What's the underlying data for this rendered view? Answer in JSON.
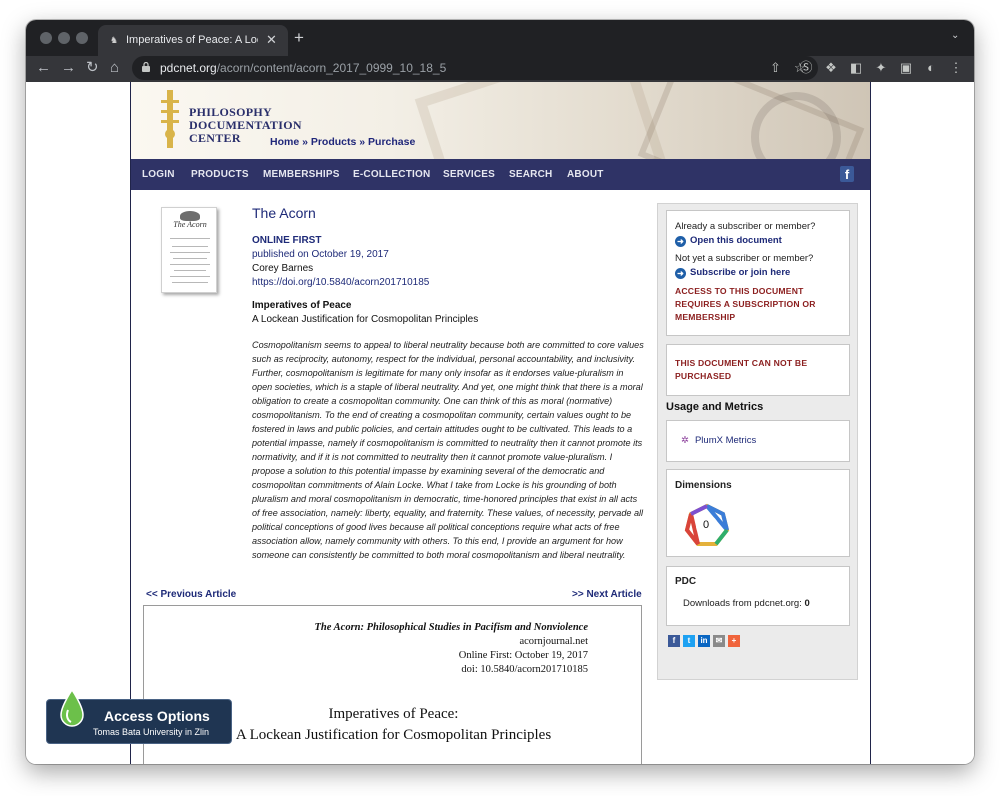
{
  "browser": {
    "tab_title": "Imperatives of Peace: A Locke",
    "url_host": "pdcnet.org",
    "url_path": "/acorn/content/acorn_2017_0999_10_18_5"
  },
  "site": {
    "logo_line1": "PHILOSOPHY",
    "logo_line2": "DOCUMENTATION",
    "logo_line3": "CENTER",
    "breadcrumb": "Home » Products » Purchase",
    "nav": [
      "LOGIN",
      "PRODUCTS",
      "MEMBERSHIPS",
      "E-COLLECTION",
      "SERVICES",
      "SEARCH",
      "ABOUT"
    ],
    "facebook_icon": "f"
  },
  "cover": {
    "title": "The Acorn"
  },
  "article": {
    "journal": "The Acorn",
    "status": "ONLINE FIRST",
    "published": "published on October 19, 2017",
    "author": "Corey Barnes",
    "doi": "https://doi.org/10.5840/acorn201710185",
    "title": "Imperatives of Peace",
    "subtitle": "A Lockean Justification for Cosmopolitan Principles",
    "abstract": "Cosmopolitanism seems to appeal to liberal neutrality because both are committed to core values such as reciprocity, autonomy, respect for the individual, personal accountability, and inclusivity. Further, cosmopolitanism is legitimate for many only insofar as it endorses value-pluralism in open societies, which is a staple of liberal neutrality. And yet, one might think that there is a moral obligation to create a cosmopolitan community. One can think of this as moral (normative) cosmopolitanism. To the end of creating a cosmopolitan community, certain values ought to be fostered in laws and public policies, and certain attitudes ought to be cultivated. This leads to a potential impasse, namely if cosmopolitanism is committed to neutrality then it cannot promote its normativity, and if it is not committed to neutrality then it cannot promote value-pluralism. I propose a solution to this potential impasse by examining several of the democratic and cosmopolitan commitments of Alain Locke. What I take from Locke is his grounding of both pluralism and moral cosmopolitanism in democratic, time-honored principles that exist in all acts of free association, namely: liberty, equality, and fraternity. These values, of necessity, pervade all political conceptions of good lives because all political conceptions require what acts of free association allow, namely community with others. To this end, I provide an argument for how someone can consistently be committed to both moral cosmopolitanism and liberal neutrality.",
    "prev": "<< Previous Article",
    "next": ">> Next Article"
  },
  "pdf": {
    "journal_line": "The Acorn: Philosophical Studies in Pacifism and Nonviolence",
    "site_line": "acornjournal.net",
    "date_line": "Online First: October 19, 2017",
    "doi_line": "doi: 10.5840/acorn201710185",
    "title_line1": "Imperatives of Peace:",
    "title_line2": "A Lockean Justification for Cosmopolitan Principles"
  },
  "sidebar": {
    "subscriber_q": "Already a subscriber or member?",
    "open_doc": "Open this document",
    "notyet_q": "Not yet a subscriber or member?",
    "subscribe": "Subscribe or join here",
    "access_warning": "ACCESS TO THIS DOCUMENT REQUIRES A SUBSCRIPTION OR MEMBERSHIP",
    "purchase_warning": "THIS DOCUMENT CAN NOT BE PURCHASED",
    "usage_heading": "Usage and Metrics",
    "plumx": "PlumX Metrics",
    "dimensions_heading": "Dimensions",
    "dimensions_value": "0",
    "pdc_heading": "PDC",
    "downloads_label": "Downloads from pdcnet.org:",
    "downloads_value": "0",
    "share_icons": [
      "facebook-icon",
      "twitter-icon",
      "linkedin-icon",
      "email-icon",
      "more-icon"
    ]
  },
  "access_options": {
    "label": "Access Options",
    "institution": "Tomas Bata University in Zlin"
  },
  "colors": {
    "nav_bg": "#2f3366",
    "link": "#1e2a78",
    "warning": "#8b1e1e",
    "sidebar_bg": "#ebebeb",
    "access_bg": "#1f3552"
  }
}
